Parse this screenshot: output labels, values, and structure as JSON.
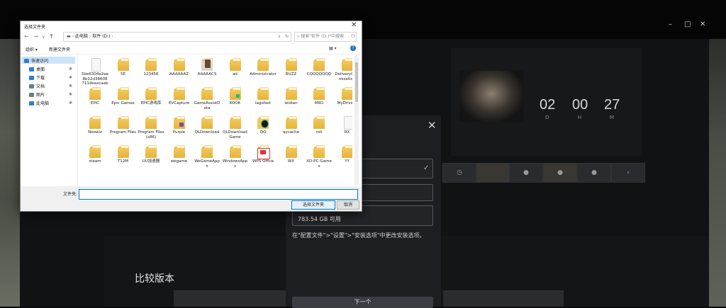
{
  "background_app": {
    "window_controls": [
      "–",
      "□",
      "✕"
    ],
    "countdown": [
      {
        "value": "02",
        "unit": "D"
      },
      {
        "value": "00",
        "unit": "H"
      },
      {
        "value": "27",
        "unit": "M"
      }
    ],
    "compare_title": "比较版本",
    "next_arrow": "›"
  },
  "install_dialog": {
    "close": "✕",
    "check": "✓",
    "disk_free": "783.54 GB 可用",
    "hint": "在\"配置文件\">\"设置\">\"安装选项\"中更改安装选项。",
    "next_button": "下一个"
  },
  "file_dialog": {
    "title": "选择文件夹",
    "close": "✕",
    "address": {
      "segments": [
        "此电脑",
        "软件 (D:)"
      ]
    },
    "search_placeholder": "搜索\"软件 (D:)\"中搜索",
    "toolbar": {
      "organize": "组织 ▾",
      "new_folder": "新建文件夹"
    },
    "sidebar": [
      {
        "label": "快速访问",
        "icon": "star-icon",
        "color": "#3a7bd5"
      },
      {
        "label": "桌面",
        "icon": "desktop-icon",
        "color": "#2f7fd0"
      },
      {
        "label": "下载",
        "icon": "download-icon",
        "color": "#2f7fd0"
      },
      {
        "label": "文档",
        "icon": "document-icon",
        "color": "#6b7b8c"
      },
      {
        "label": "图片",
        "icon": "picture-icon",
        "color": "#6b7b8c"
      },
      {
        "label": "此电脑",
        "icon": "computer-icon",
        "color": "#2f7fd0"
      }
    ],
    "folders": [
      {
        "name": "5be6304e2ae8b12d38608711deaxcaab",
        "kind": "blank"
      },
      {
        "name": "5E",
        "kind": "folder"
      },
      {
        "name": "123456",
        "kind": "folder"
      },
      {
        "name": "AAAAAAZ",
        "kind": "folder"
      },
      {
        "name": "AAAAACS",
        "kind": "img"
      },
      {
        "name": "ad",
        "kind": "folder"
      },
      {
        "name": "Administrator",
        "kind": "folder"
      },
      {
        "name": "BUZZ",
        "kind": "folder"
      },
      {
        "name": "CQQQQQQQ",
        "kind": "folder"
      },
      {
        "name": "DeliveryOptimization",
        "kind": "folder"
      },
      {
        "name": "EPIC",
        "kind": "folder"
      },
      {
        "name": "Epic Games",
        "kind": "folder"
      },
      {
        "name": "EPIC游戏库",
        "kind": "folder"
      },
      {
        "name": "EVCapture",
        "kind": "folder"
      },
      {
        "name": "GameAssistData",
        "kind": "folder"
      },
      {
        "name": "KOOK",
        "kind": "kook"
      },
      {
        "name": "lagofast",
        "kind": "folder"
      },
      {
        "name": "leidian",
        "kind": "folder"
      },
      {
        "name": "MKO",
        "kind": "folder"
      },
      {
        "name": "MyDrivers",
        "kind": "folder"
      },
      {
        "name": "Neowiz",
        "kind": "folder"
      },
      {
        "name": "Program Files",
        "kind": "folder"
      },
      {
        "name": "Program Files (x86)",
        "kind": "folder"
      },
      {
        "name": "Purple",
        "kind": "purple"
      },
      {
        "name": "QLDownload",
        "kind": "folder"
      },
      {
        "name": "QLDownloadGame",
        "kind": "folder"
      },
      {
        "name": "QQ",
        "kind": "qq"
      },
      {
        "name": "qycache",
        "kind": "folder"
      },
      {
        "name": "roit",
        "kind": "folder"
      },
      {
        "name": "RX",
        "kind": "blank"
      },
      {
        "name": "steam",
        "kind": "folder"
      },
      {
        "name": "T12M",
        "kind": "folder"
      },
      {
        "name": "UU加速器",
        "kind": "folder"
      },
      {
        "name": "wegame",
        "kind": "folder"
      },
      {
        "name": "WeGameApps",
        "kind": "folder"
      },
      {
        "name": "WindowsApps",
        "kind": "folder"
      },
      {
        "name": "WPS Office",
        "kind": "wps"
      },
      {
        "name": "WX",
        "kind": "folder"
      },
      {
        "name": "XD-PC-Games",
        "kind": "folder"
      },
      {
        "name": "YY",
        "kind": "folder"
      }
    ],
    "filename_label": "文件夹:",
    "filename_value": "",
    "select_button": "选择文件夹",
    "cancel_button": "取消"
  }
}
